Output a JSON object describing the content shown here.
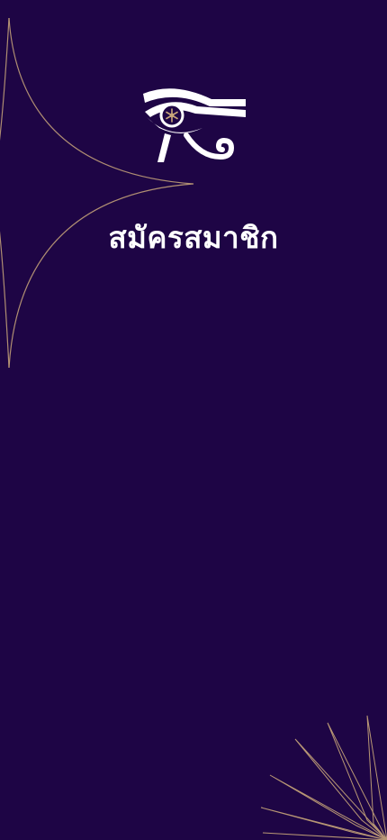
{
  "app": {
    "title": "สมัครสมาชิก",
    "logo_icon": "eye-of-horus-icon"
  },
  "theme": {
    "background": "#1e0545",
    "accent": "#c9a77a",
    "text": "#ffffff"
  }
}
